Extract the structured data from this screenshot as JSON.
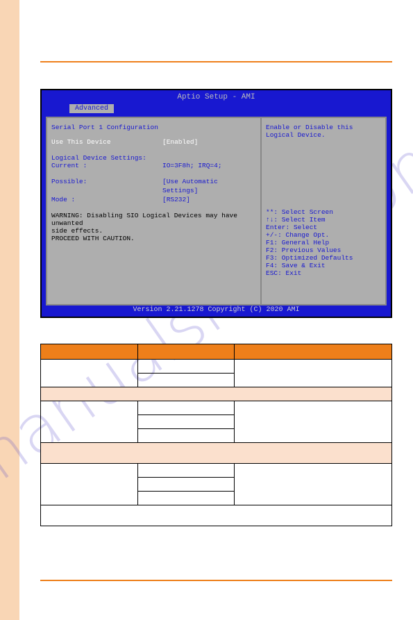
{
  "watermark": "manualshive.com",
  "bios": {
    "title": "Aptio Setup - AMI",
    "tab": "Advanced",
    "section_title": "Serial Port  1 Configuration",
    "rows": [
      {
        "label": "Use This Device",
        "value": "[Enabled]",
        "lwhite": true,
        "vwhite": true
      }
    ],
    "settings_header": "Logical Device Settings:",
    "current": {
      "label": "Current :",
      "value": "IO=3F8h; IRQ=4;"
    },
    "possible": {
      "label": "Possible:",
      "value1": "[Use Automatic",
      "value2": "Settings]"
    },
    "mode": {
      "label": "Mode   :",
      "value": "[RS232]"
    },
    "warning1": "WARNING: Disabling SIO Logical Devices may have unwanted",
    "warning2": "side effects.",
    "caution": "PROCEED WITH CAUTION.",
    "help_top": "Enable or Disable this Logical Device.",
    "keys": [
      "**: Select Screen",
      "↑↓: Select Item",
      "Enter: Select",
      "+/-: Change Opt.",
      "F1: General Help",
      "F2: Previous Values",
      "F3: Optimized Defaults",
      "F4: Save & Exit",
      "ESC: Exit"
    ],
    "footer": "Version 2.21.1278 Copyright (C) 2020 AMI"
  }
}
